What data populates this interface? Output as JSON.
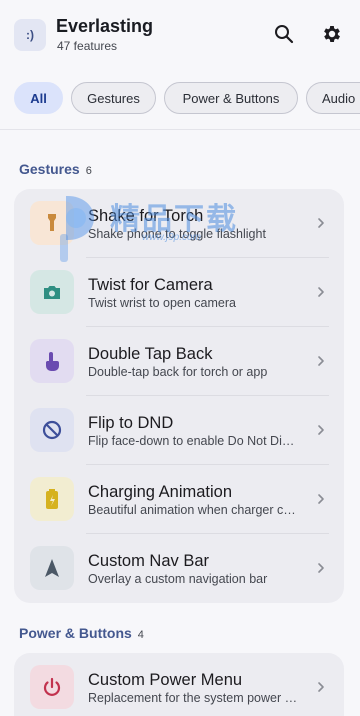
{
  "header": {
    "logo_text": ":)",
    "title": "Everlasting",
    "subtitle": "47 features",
    "icons": [
      "search-icon",
      "gear-icon"
    ]
  },
  "chips": [
    {
      "label": "All",
      "active": true
    },
    {
      "label": "Gestures",
      "active": false
    },
    {
      "label": "Power & Buttons",
      "active": false
    },
    {
      "label": "Audio",
      "active": false
    }
  ],
  "sections": [
    {
      "title": "Gestures",
      "count": "6",
      "items": [
        {
          "title": "Shake for Torch",
          "subtitle": "Shake phone to toggle flashlight",
          "icon": "torch-icon",
          "icon_bg": "#f8e6d6",
          "icon_color": "#c98a3d"
        },
        {
          "title": "Twist for Camera",
          "subtitle": "Twist wrist to open camera",
          "icon": "camera-icon",
          "icon_bg": "#d5e7e4",
          "icon_color": "#2f8f82"
        },
        {
          "title": "Double Tap Back",
          "subtitle": "Double-tap back for torch or app",
          "icon": "tap-icon",
          "icon_bg": "#e2dcf1",
          "icon_color": "#6a4bb0"
        },
        {
          "title": "Flip to DND",
          "subtitle": "Flip face-down to enable Do Not Disturb",
          "icon": "dnd-icon",
          "icon_bg": "#dfe2f1",
          "icon_color": "#3d4f9a"
        },
        {
          "title": "Charging Animation",
          "subtitle": "Beautiful animation when charger connected",
          "icon": "battery-icon",
          "icon_bg": "#f2edd1",
          "icon_color": "#d6b21f"
        },
        {
          "title": "Custom Nav Bar",
          "subtitle": "Overlay a custom navigation bar",
          "icon": "navigation-icon",
          "icon_bg": "#dfe3e8",
          "icon_color": "#4b5866"
        }
      ]
    },
    {
      "title": "Power & Buttons",
      "count": "4",
      "items": [
        {
          "title": "Custom Power Menu",
          "subtitle": "Replacement for the system power menu",
          "icon": "power-icon",
          "icon_bg": "#f3dbe1",
          "icon_color": "#c2324e"
        }
      ]
    }
  ],
  "watermark": {
    "text_cn": "精品下载",
    "url": "www.j9p.com"
  }
}
